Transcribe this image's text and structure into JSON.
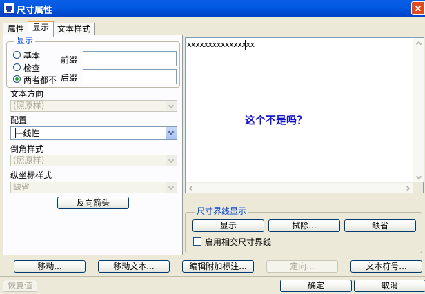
{
  "window": {
    "title": "尺寸属性"
  },
  "tabs": [
    {
      "label": "属性",
      "active": false
    },
    {
      "label": "显示",
      "active": true
    },
    {
      "label": "文本样式",
      "active": false
    }
  ],
  "display_group": {
    "legend": "显示",
    "radios": [
      {
        "label": "基本",
        "checked": false
      },
      {
        "label": "检查",
        "checked": false
      },
      {
        "label": "两者都不",
        "checked": true
      }
    ],
    "prefix_label": "前缀",
    "prefix_value": "",
    "suffix_label": "后缀",
    "suffix_value": ""
  },
  "text_direction": {
    "label": "文本方向",
    "value": "(照原样)",
    "enabled": false
  },
  "config": {
    "label": "配置",
    "value": "├─线性",
    "enabled": true
  },
  "chamfer_style": {
    "label": "倒角样式",
    "value": "(照原样)",
    "enabled": false
  },
  "ordinate_style": {
    "label": "纵坐标样式",
    "value": "缺省",
    "enabled": false
  },
  "reverse_arrow_button": "反向箭头",
  "preview": {
    "text": "xxxxxxxxxxxxxxxx",
    "caption": "这个不是吗？"
  },
  "witness_group": {
    "legend": "尺寸界线显示",
    "show_button": "显示",
    "erase_button": "拭除...",
    "default_button": "缺省",
    "intersect_checkbox": {
      "label": "启用相交尺寸界线",
      "checked": false
    }
  },
  "bottom_buttons": {
    "move": "移动...",
    "move_text": "移动文本...",
    "edit_attach": "编辑附加标注...",
    "orient": "定向...",
    "text_symbol": "文本符号...",
    "restore": "恢复值",
    "ok": "确定",
    "cancel": "取消"
  },
  "colors": {
    "title_bar": "#0054e3",
    "accent_text": "#1515c6",
    "group_legend": "#0046d5"
  }
}
